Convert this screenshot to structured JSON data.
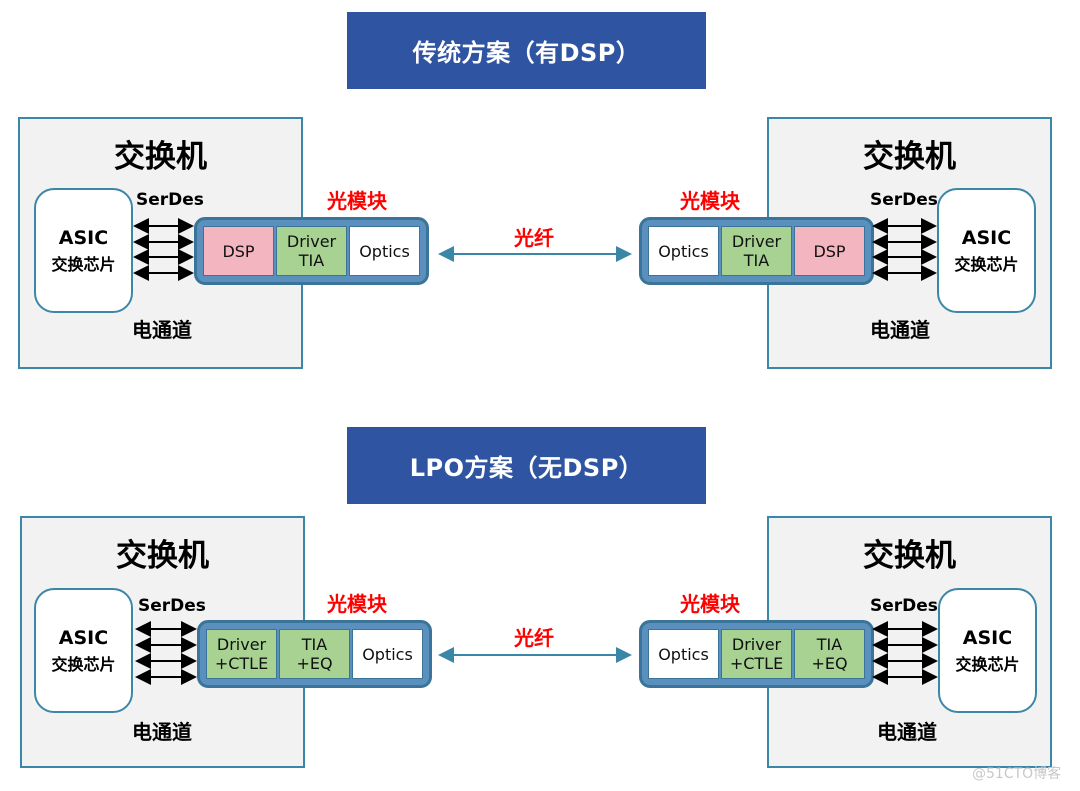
{
  "sections": [
    {
      "title": "传统方案（有DSP）",
      "left_switch": {
        "title": "交换机",
        "asic_name": "ASIC",
        "asic_sub": "交换芯片",
        "serdes_label": "SerDes",
        "channel_label": "电通道",
        "module_label": "光模块",
        "module_cells": [
          {
            "text": "DSP",
            "color": "pink"
          },
          {
            "text": "Driver\nTIA",
            "color": "green"
          },
          {
            "text": "Optics",
            "color": "white"
          }
        ]
      },
      "fiber_label": "光纤",
      "right_switch": {
        "title": "交换机",
        "asic_name": "ASIC",
        "asic_sub": "交换芯片",
        "serdes_label": "SerDes",
        "channel_label": "电通道",
        "module_label": "光模块",
        "module_cells": [
          {
            "text": "Optics",
            "color": "white"
          },
          {
            "text": "Driver\nTIA",
            "color": "green"
          },
          {
            "text": "DSP",
            "color": "pink"
          }
        ]
      }
    },
    {
      "title": "LPO方案（无DSP）",
      "left_switch": {
        "title": "交换机",
        "asic_name": "ASIC",
        "asic_sub": "交换芯片",
        "serdes_label": "SerDes",
        "channel_label": "电通道",
        "module_label": "光模块",
        "module_cells": [
          {
            "text": "Driver\n+CTLE",
            "color": "green"
          },
          {
            "text": "TIA\n+EQ",
            "color": "green"
          },
          {
            "text": "Optics",
            "color": "white"
          }
        ]
      },
      "fiber_label": "光纤",
      "right_switch": {
        "title": "交换机",
        "asic_name": "ASIC",
        "asic_sub": "交换芯片",
        "serdes_label": "SerDes",
        "channel_label": "电通道",
        "module_label": "光模块",
        "module_cells": [
          {
            "text": "Optics",
            "color": "white"
          },
          {
            "text": "Driver\n+CTLE",
            "color": "green"
          },
          {
            "text": "TIA\n+EQ",
            "color": "green"
          }
        ]
      }
    }
  ],
  "colors": {
    "banner": "#2f54a1",
    "border": "#3b87a8",
    "module_frame": "#5a8fbe",
    "dsp_pink": "#f3b5bf",
    "driver_green": "#a7d292",
    "label_red": "#ff0000",
    "fiber_arrow": "#3a86a6"
  },
  "watermark": "@51CTO博客"
}
